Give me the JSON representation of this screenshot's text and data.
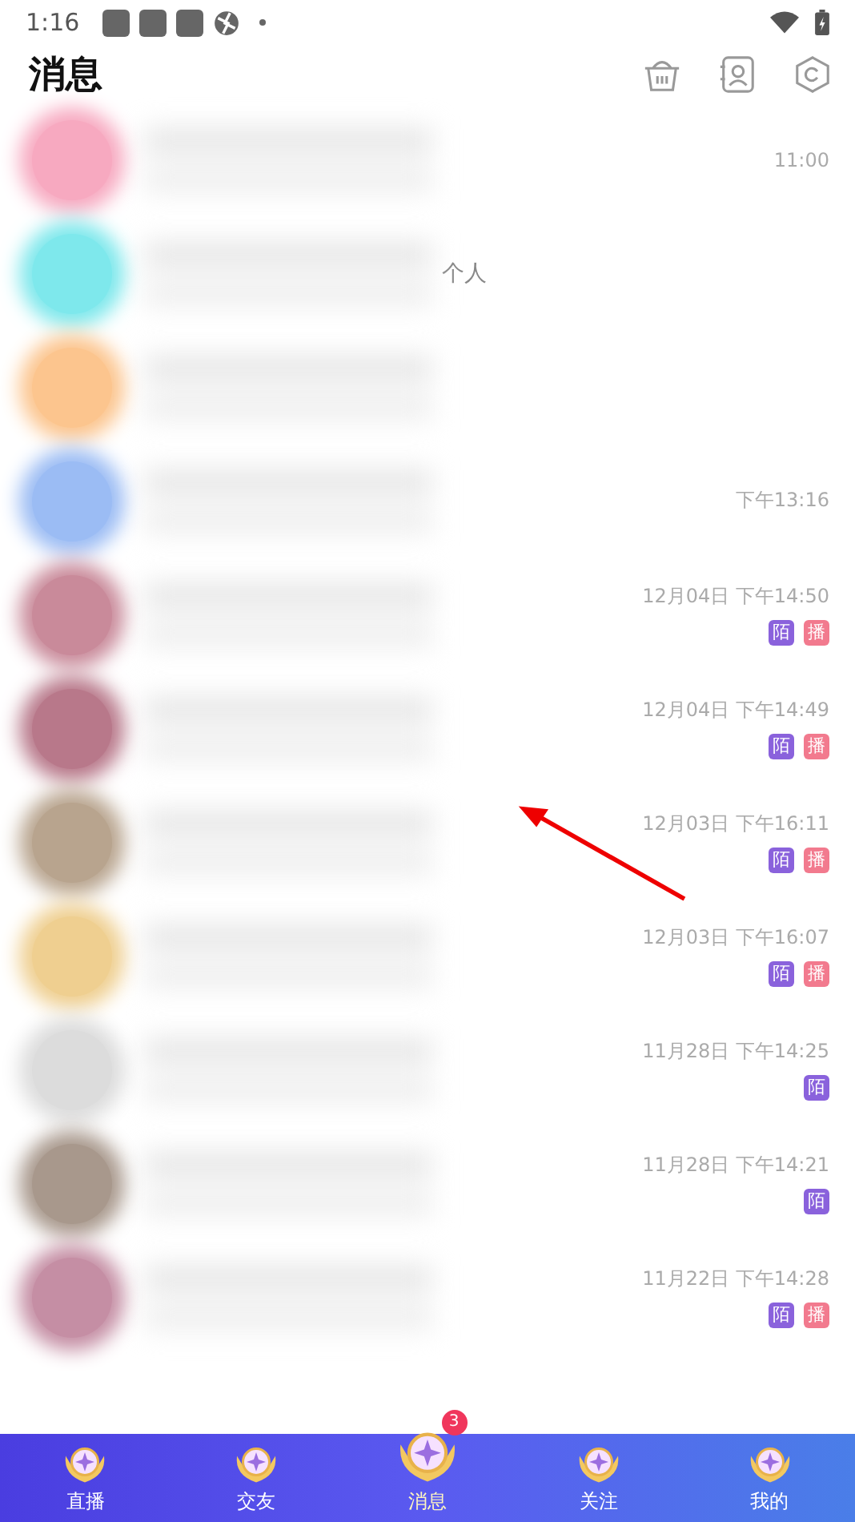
{
  "status_bar": {
    "time": "1:16"
  },
  "header": {
    "title": "消息"
  },
  "conversations": [
    {
      "color": "#f7a9c0",
      "time": "11:00"
    },
    {
      "color": "#7ee8ec",
      "preview": "个人"
    },
    {
      "color": "#fcc58e"
    },
    {
      "color": "#9bbcf4",
      "time": "下午13:16"
    },
    {
      "color": "#c98a9a",
      "time": "12月04日 下午14:50",
      "badges": [
        {
          "kind": "mo",
          "label": "陌"
        },
        {
          "kind": "bo",
          "label": "播"
        }
      ]
    },
    {
      "color": "#b8788a",
      "time": "12月04日 下午14:49",
      "badges": [
        {
          "kind": "mo",
          "label": "陌"
        },
        {
          "kind": "bo",
          "label": "播"
        }
      ]
    },
    {
      "color": "#b8a48e",
      "time": "12月03日 下午16:11",
      "badges": [
        {
          "kind": "mo",
          "label": "陌"
        },
        {
          "kind": "bo",
          "label": "播"
        }
      ]
    },
    {
      "color": "#efcf90",
      "time": "12月03日 下午16:07",
      "badges": [
        {
          "kind": "mo",
          "label": "陌"
        },
        {
          "kind": "bo",
          "label": "播"
        }
      ]
    },
    {
      "color": "#dcdcdc",
      "time": "11月28日 下午14:25",
      "badges": [
        {
          "kind": "mo",
          "label": "陌"
        }
      ]
    },
    {
      "color": "#a8988c",
      "time": "11月28日 下午14:21",
      "badges": [
        {
          "kind": "mo",
          "label": "陌"
        }
      ]
    },
    {
      "color": "#c58ea4",
      "time": "11月22日 下午14:28",
      "badges": [
        {
          "kind": "mo",
          "label": "陌"
        },
        {
          "kind": "bo",
          "label": "播"
        }
      ]
    }
  ],
  "bottom_nav": [
    {
      "label": "直播",
      "selected": false
    },
    {
      "label": "交友",
      "selected": false
    },
    {
      "label": "消息",
      "selected": true,
      "badge": "3"
    },
    {
      "label": "关注",
      "selected": false
    },
    {
      "label": "我的",
      "selected": false
    }
  ]
}
